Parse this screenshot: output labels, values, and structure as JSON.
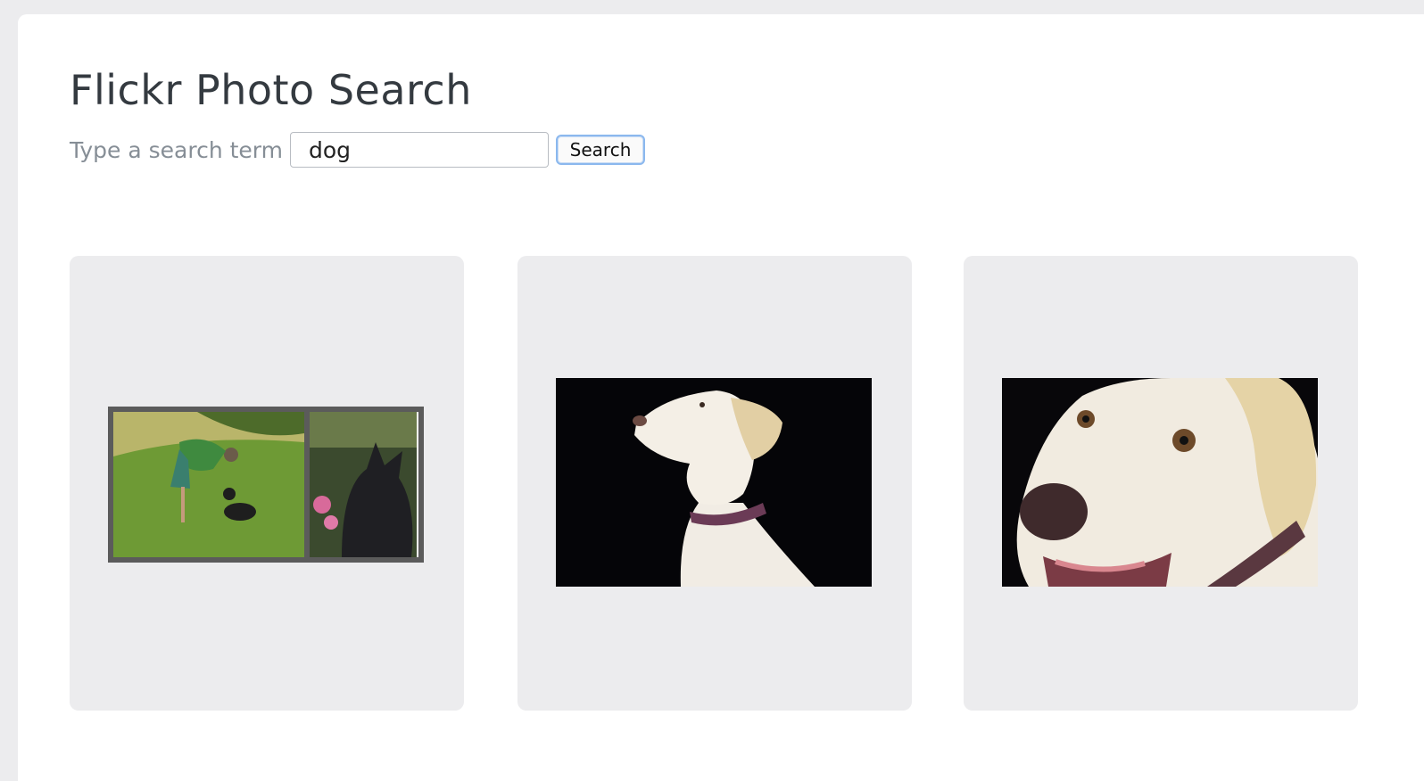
{
  "header": {
    "title": "Flickr Photo Search"
  },
  "search": {
    "label": "Type a search term",
    "value": "dog",
    "button_label": "Search"
  },
  "results": [
    {
      "name": "photo-dog-person-and-shepherd"
    },
    {
      "name": "photo-yellow-lab-profile"
    },
    {
      "name": "photo-yellow-lab-closeup"
    }
  ]
}
